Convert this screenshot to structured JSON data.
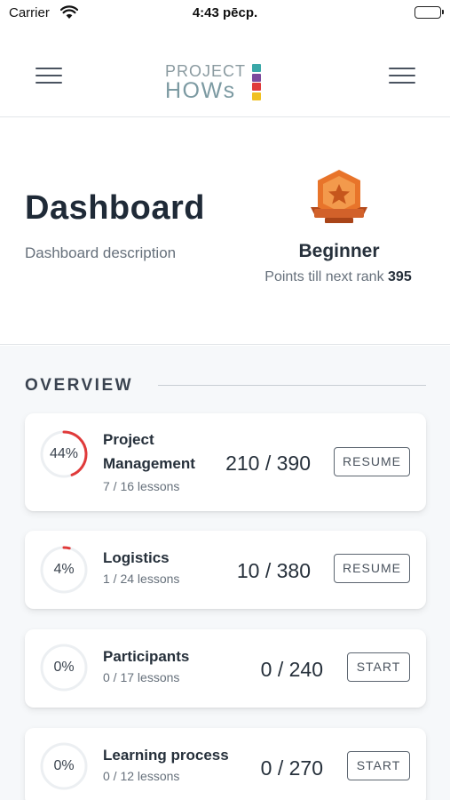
{
  "status_bar": {
    "carrier": "Carrier",
    "time": "4:43 pēcp."
  },
  "header": {
    "logo_line1": "PROJECT",
    "logo_line2": "HOWs",
    "logo_colors": [
      "#3aa8a8",
      "#7c4a9c",
      "#e03a3a",
      "#f0c020"
    ],
    "left_menu_icon": "hamburger-icon",
    "right_menu_icon": "hamburger-icon"
  },
  "hero": {
    "title": "Dashboard",
    "description": "Dashboard description",
    "rank_name": "Beginner",
    "points_label": "Points till next rank",
    "points_value": "395",
    "badge_icon": "bronze-star-badge-icon",
    "badge_color": "#e8742a"
  },
  "overview": {
    "heading": "OVERVIEW",
    "accent_color": "#e03a3a",
    "items": [
      {
        "percent_label": "44%",
        "progress": 0.44,
        "name": "Project Management",
        "lessons": "7 / 16 lessons",
        "score": "210 / 390",
        "action": "RESUME"
      },
      {
        "percent_label": "4%",
        "progress": 0.04,
        "name": "Logistics",
        "lessons": "1 / 24 lessons",
        "score": "10 / 380",
        "action": "RESUME"
      },
      {
        "percent_label": "0%",
        "progress": 0,
        "name": "Participants",
        "lessons": "0 / 17 lessons",
        "score": "0 / 240",
        "action": "START"
      },
      {
        "percent_label": "0%",
        "progress": 0,
        "name": "Learning process",
        "lessons": "0 / 12 lessons",
        "score": "0 / 270",
        "action": "START"
      }
    ]
  }
}
